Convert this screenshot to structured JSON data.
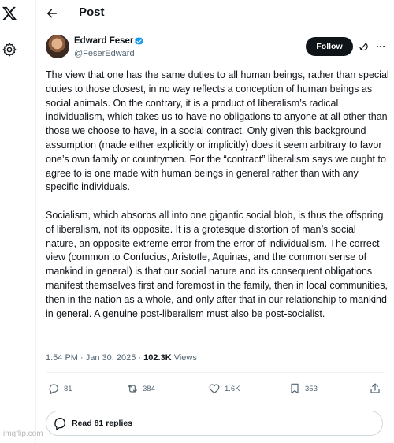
{
  "header": {
    "title": "Post"
  },
  "author": {
    "display_name": "Edward Feser",
    "handle": "@FeserEdward",
    "follow_label": "Follow"
  },
  "tweet": {
    "paragraphs": [
      "The view that one has the same duties to all human beings, rather than special duties to those closest, in no way reflects a conception of human beings as social animals. On the contrary, it is a product of liberalism’s radical individualism, which takes us to have no obligations to anyone at all other than those we choose to have, in a social contract. Only given this background assumption (made either explicitly or implicitly) does it seem arbitrary to favor one’s own family or countrymen. For the “contract” liberalism says we ought to agree to is one made with human beings in general rather than with any specific individuals.",
      "Socialism, which absorbs all into one gigantic social blob, is thus the offspring of liberalism, not its opposite. It is a grotesque distortion of man’s social nature, an opposite extreme error from the error of individualism. The correct view (common to Confucius, Aristotle, Aquinas, and the common sense of mankind in general) is that our social nature and its consequent obligations manifest themselves first and foremost in the family, then in local communities, then in the nation as a whole, and only after that in our relationship to mankind in general. A genuine post-liberalism must also be post-socialist."
    ],
    "timestamp": "1:54 PM · Jan 30, 2025",
    "separator": "·",
    "views_count": "102.3K",
    "views_label": "Views"
  },
  "actions": {
    "replies": "81",
    "reposts": "384",
    "likes": "1.6K",
    "bookmarks": "353"
  },
  "read_replies_label": "Read 81 replies",
  "watermark": "imgflip.com",
  "icons": [
    "x-logo-icon",
    "settings-icon",
    "back-arrow-icon",
    "verified-badge-icon",
    "grok-icon",
    "more-icon",
    "reply-icon",
    "repost-icon",
    "like-icon",
    "bookmark-icon",
    "share-icon",
    "reply-bubble-icon"
  ],
  "colors": {
    "text": "#0f1419",
    "secondary": "#536471",
    "verified": "#1d9bf0",
    "follow_bg": "#0f1419",
    "border": "#cfd9de"
  }
}
